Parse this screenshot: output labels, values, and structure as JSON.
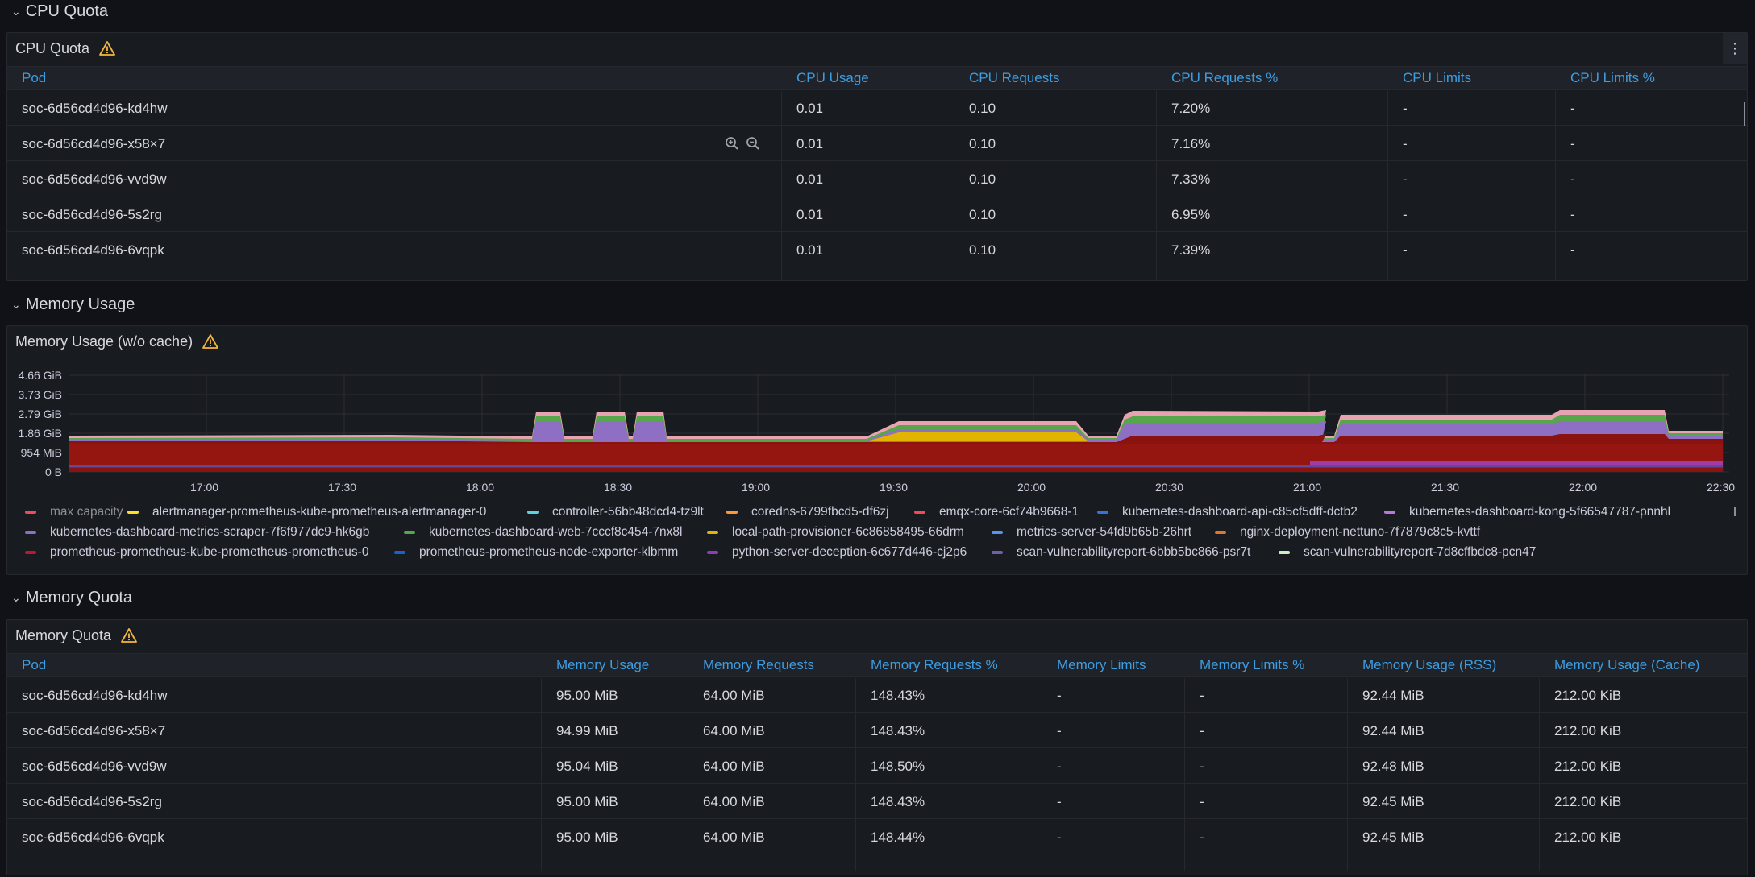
{
  "rows": {
    "cpu_quota": "CPU Quota",
    "memory_usage": "Memory Usage",
    "memory_quota": "Memory Quota"
  },
  "cpu_panel": {
    "title": "CPU Quota",
    "columns": [
      "Pod",
      "CPU Usage",
      "CPU Requests",
      "CPU Requests %",
      "CPU Limits",
      "CPU Limits %"
    ],
    "rows": [
      [
        "soc-6d56cd4d96-kd4hw",
        "0.01",
        "0.10",
        "7.20%",
        "-",
        "-"
      ],
      [
        "soc-6d56cd4d96-x58×7",
        "0.01",
        "0.10",
        "7.16%",
        "-",
        "-"
      ],
      [
        "soc-6d56cd4d96-vvd9w",
        "0.01",
        "0.10",
        "7.33%",
        "-",
        "-"
      ],
      [
        "soc-6d56cd4d96-5s2rg",
        "0.01",
        "0.10",
        "6.95%",
        "-",
        "-"
      ],
      [
        "soc-6d56cd4d96-6vqpk",
        "0.01",
        "0.10",
        "7.39%",
        "-",
        "-"
      ]
    ]
  },
  "memory_panel": {
    "title": "Memory Usage (w/o cache)",
    "y_ticks": [
      "4.66 GiB",
      "3.73 GiB",
      "2.79 GiB",
      "1.86 GiB",
      "954 MiB",
      "0 B"
    ],
    "x_ticks": [
      "17:00",
      "17:30",
      "18:00",
      "18:30",
      "19:00",
      "19:30",
      "20:00",
      "20:30",
      "21:00",
      "21:30",
      "22:00",
      "22:30"
    ],
    "legend": [
      {
        "name": "max capacity",
        "color": "#f2495c",
        "dim": true
      },
      {
        "name": "alertmanager-prometheus-kube-prometheus-alertmanager-0",
        "color": "#fade2a"
      },
      {
        "name": "controller-56bb48dcd4-tz9lt",
        "color": "#5794f2"
      },
      {
        "name": "coredns-6799fbcd5-df6zj",
        "color": "#ff9830"
      },
      {
        "name": "emqx-core-6cf74b9668-1",
        "color": "#f2495c"
      },
      {
        "name": "kubernetes-dashboard-api-c85cf5dff-dctb2",
        "color": "#3274d9"
      },
      {
        "name": "kubernetes-dashboard-kong-5f66547787-pnnhl",
        "color": "#b877d9"
      },
      {
        "name": "kubernetes-dashboard-metrics-scraper-7f6f977dc9-hk6gb",
        "color": "#8f6fc4"
      },
      {
        "name": "kubernetes-dashboard-web-7cccf8c454-7nx8l",
        "color": "#56a64b"
      },
      {
        "name": "local-path-provisioner-6c86858495-66drm",
        "color": "#e0b400"
      },
      {
        "name": "metrics-server-54fd9b65b-26hrt",
        "color": "#5794f2"
      },
      {
        "name": "nginx-deployment-nettuno-7f7879c8c5-kvttf",
        "color": "#e0752d"
      },
      {
        "name": "prometheus-prometheus-kube-prometheus-prometheus-0",
        "color": "#c4162a"
      },
      {
        "name": "prometheus-prometheus-node-exporter-klbmm",
        "color": "#1f60c4"
      },
      {
        "name": "python-server-deception-6c677d446-cj2p6",
        "color": "#8f3bb8"
      },
      {
        "name": "scan-vulnerabilityreport-6bbb5bc866-psr7t",
        "color": "#6e5fa6"
      },
      {
        "name": "scan-vulnerabilityreport-7d8cffbdc8-pcn47",
        "color": "#c8f2c2"
      }
    ]
  },
  "memquota_panel": {
    "title": "Memory Quota",
    "columns": [
      "Pod",
      "Memory Usage",
      "Memory Requests",
      "Memory Requests %",
      "Memory Limits",
      "Memory Limits %",
      "Memory Usage (RSS)",
      "Memory Usage (Cache)"
    ],
    "rows": [
      [
        "soc-6d56cd4d96-kd4hw",
        "95.00 MiB",
        "64.00 MiB",
        "148.43%",
        "-",
        "-",
        "92.44 MiB",
        "212.00 KiB"
      ],
      [
        "soc-6d56cd4d96-x58×7",
        "94.99 MiB",
        "64.00 MiB",
        "148.43%",
        "-",
        "-",
        "92.44 MiB",
        "212.00 KiB"
      ],
      [
        "soc-6d56cd4d96-vvd9w",
        "95.04 MiB",
        "64.00 MiB",
        "148.50%",
        "-",
        "-",
        "92.48 MiB",
        "212.00 KiB"
      ],
      [
        "soc-6d56cd4d96-5s2rg",
        "95.00 MiB",
        "64.00 MiB",
        "148.43%",
        "-",
        "-",
        "92.45 MiB",
        "212.00 KiB"
      ],
      [
        "soc-6d56cd4d96-6vqpk",
        "95.00 MiB",
        "64.00 MiB",
        "148.44%",
        "-",
        "-",
        "92.45 MiB",
        "212.00 KiB"
      ]
    ]
  }
}
